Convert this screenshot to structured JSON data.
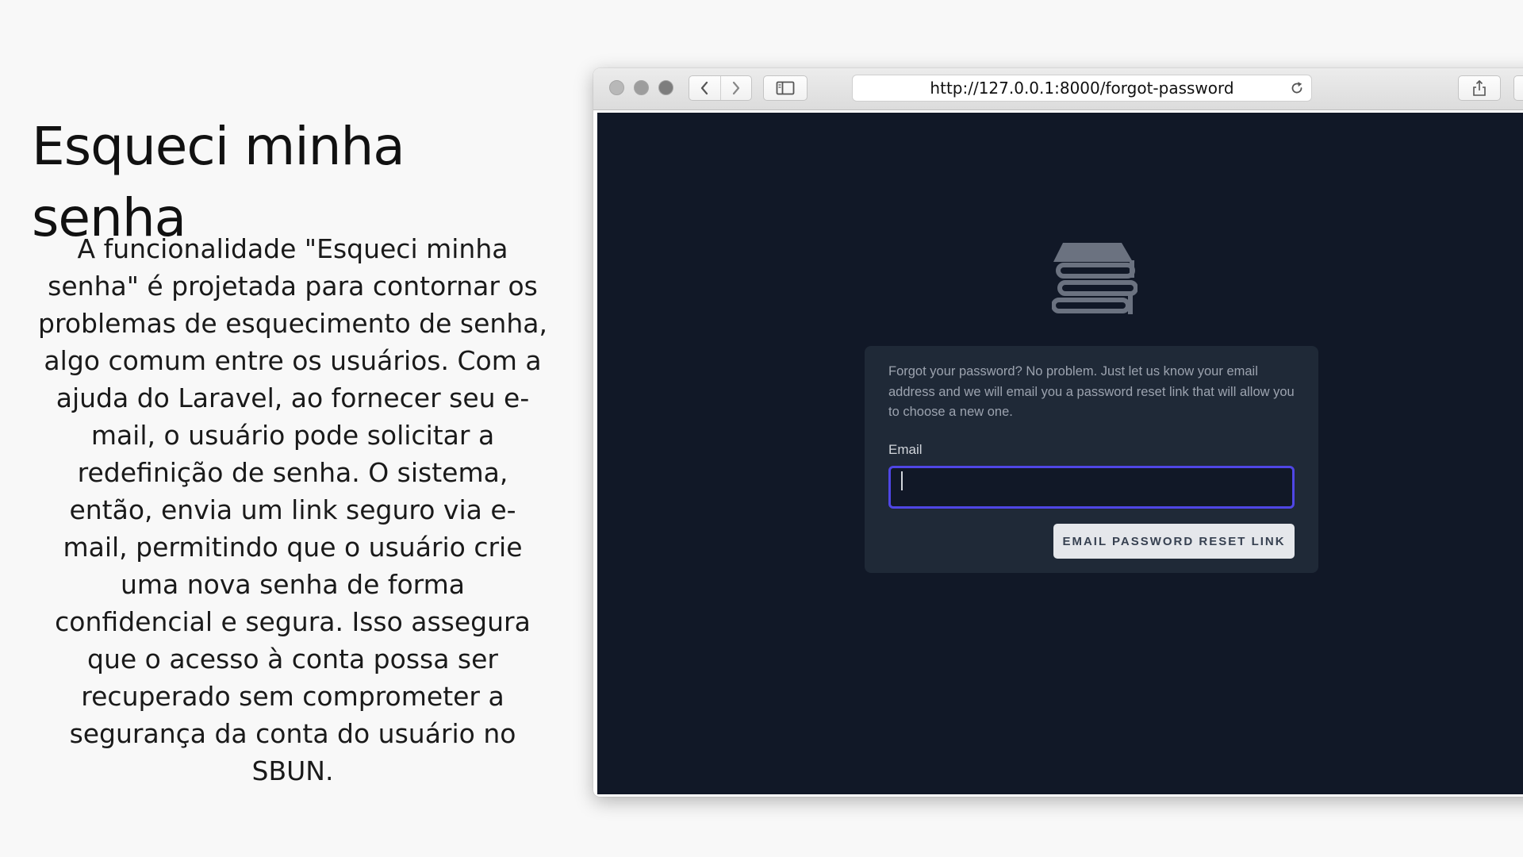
{
  "slide": {
    "title": "Esqueci minha senha",
    "body": "A funcionalidade \"Esqueci minha senha\" é projetada para contornar os problemas de esquecimento de senha, algo comum entre os usuários. Com a ajuda do Laravel, ao fornecer seu e-mail, o usuário pode solicitar a redefinição de senha. O sistema, então, envia um link seguro via e-mail, permitindo que o usuário crie uma nova senha de forma confidencial e segura. Isso assegura que o acesso à conta possa ser recuperado sem comprometer a segurança da conta do usuário no SBUN."
  },
  "browser": {
    "url": "http://127.0.0.1:8000/forgot-password",
    "icons": [
      "back-arrow-icon",
      "forward-arrow-icon",
      "sidebar-icon",
      "reload-icon",
      "share-icon"
    ]
  },
  "page": {
    "background_color": "#111827",
    "card_color": "#1f2937",
    "accent_color": "#4f46e5",
    "logo_icon": "books-icon",
    "description": "Forgot your password? No problem. Just let us know your email address and we will email you a password reset link that will allow you to choose a new one.",
    "email_label": "Email",
    "email_value": "",
    "submit_label": "EMAIL PASSWORD RESET LINK"
  }
}
